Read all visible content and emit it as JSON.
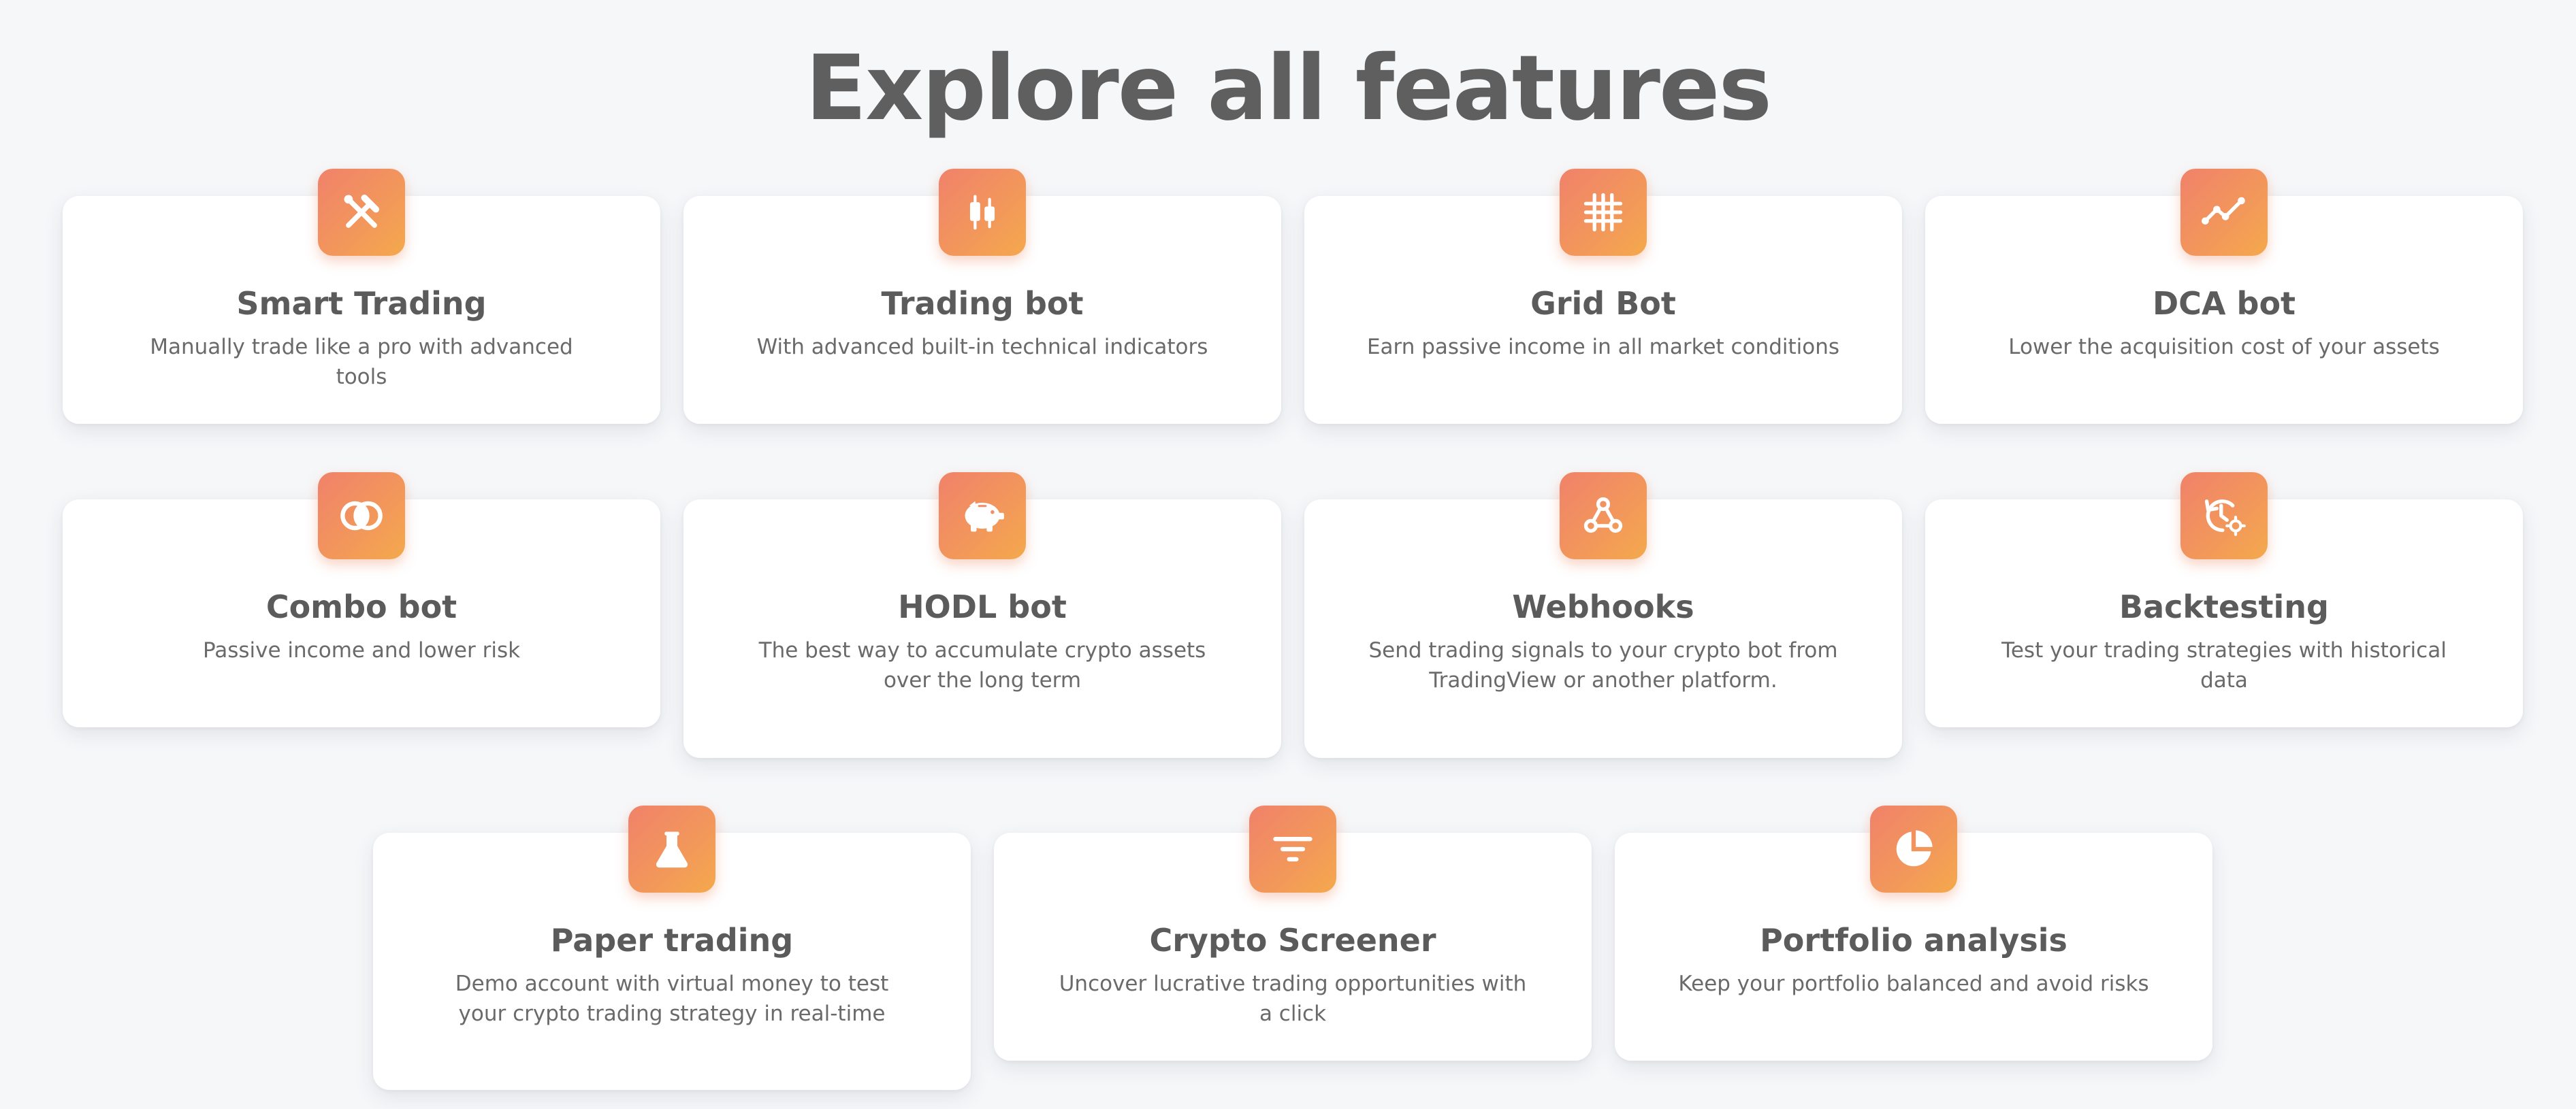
{
  "page": {
    "title": "Explore all features",
    "accent_gradient": [
      "#f0826a",
      "#f5a94c"
    ],
    "background": "#f6f7f9"
  },
  "features": [
    {
      "title": "Smart Trading",
      "desc": "Manually trade like a pro with advanced tools",
      "icon": "tools-icon"
    },
    {
      "title": "Trading bot",
      "desc": "With advanced built-in technical indicators",
      "icon": "candlestick-icon"
    },
    {
      "title": "Grid Bot",
      "desc": "Earn passive income in all market conditions",
      "icon": "grid-icon"
    },
    {
      "title": "DCA bot",
      "desc": "Lower the acquisition cost of your assets",
      "icon": "trend-line-icon"
    },
    {
      "title": "Combo bot",
      "desc": "Passive income and lower risk",
      "icon": "overlapping-circles-icon"
    },
    {
      "title": "HODL bot",
      "desc": "The best way to accumulate crypto assets over the long term",
      "icon": "piggy-bank-icon"
    },
    {
      "title": "Webhooks",
      "desc": "Send trading signals to your crypto bot from TradingView or another platform.",
      "icon": "webhook-icon"
    },
    {
      "title": "Backtesting",
      "desc": "Test your trading strategies with historical data",
      "icon": "history-gear-icon"
    },
    {
      "title": "Paper trading",
      "desc": "Demo account with virtual money to test your crypto trading strategy in real-time",
      "icon": "flask-icon"
    },
    {
      "title": "Crypto Screener",
      "desc": "Uncover lucrative trading opportunities with a click",
      "icon": "filter-icon"
    },
    {
      "title": "Portfolio analysis",
      "desc": "Keep your portfolio balanced and avoid risks",
      "icon": "pie-chart-icon"
    }
  ]
}
